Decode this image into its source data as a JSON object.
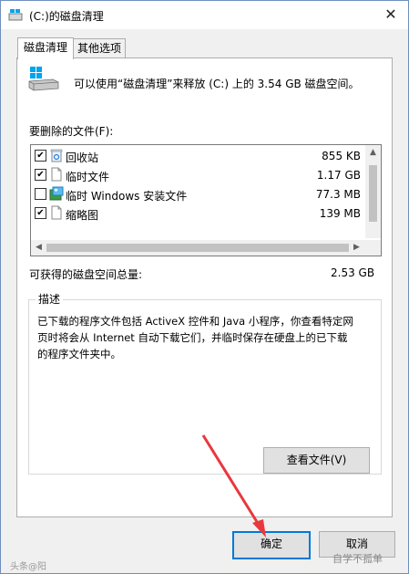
{
  "window": {
    "title": "(C:)的磁盘清理",
    "close_glyph": "✕"
  },
  "tabs": [
    {
      "label": "磁盘清理"
    },
    {
      "label": "其他选项"
    }
  ],
  "header_text": "可以使用“磁盘清理”来释放 (C:) 上的 3.54 GB 磁盘空间。",
  "files_label": "要删除的文件(F):",
  "files": [
    {
      "checked": true,
      "icon": "recycle-bin-icon",
      "name": "回收站",
      "size": "855 KB"
    },
    {
      "checked": true,
      "icon": "document-icon",
      "name": "临时文件",
      "size": "1.17 GB"
    },
    {
      "checked": false,
      "icon": "windows-setup-icon",
      "name": "临时 Windows 安装文件",
      "size": "77.3 MB"
    },
    {
      "checked": true,
      "icon": "document-icon",
      "name": "缩略图",
      "size": "139 MB"
    }
  ],
  "total_label": "可获得的磁盘空间总量:",
  "total_value": "2.53 GB",
  "description": {
    "legend": "描述",
    "line1": "已下载的程序文件包括 ActiveX 控件和 Java 小程序，你查看特定网",
    "line2": "页时将会从 Internet 自动下载它们，并临时保存在硬盘上的已下载",
    "line3": "的程序文件夹中。"
  },
  "view_files_button": "查看文件(V)",
  "ok_button": "确定",
  "cancel_button": "取消",
  "watermarks": {
    "left": "头条@阳",
    "right": "自学不孤单"
  },
  "colors": {
    "accent": "#0078d7",
    "arrow": "#e8383d"
  }
}
